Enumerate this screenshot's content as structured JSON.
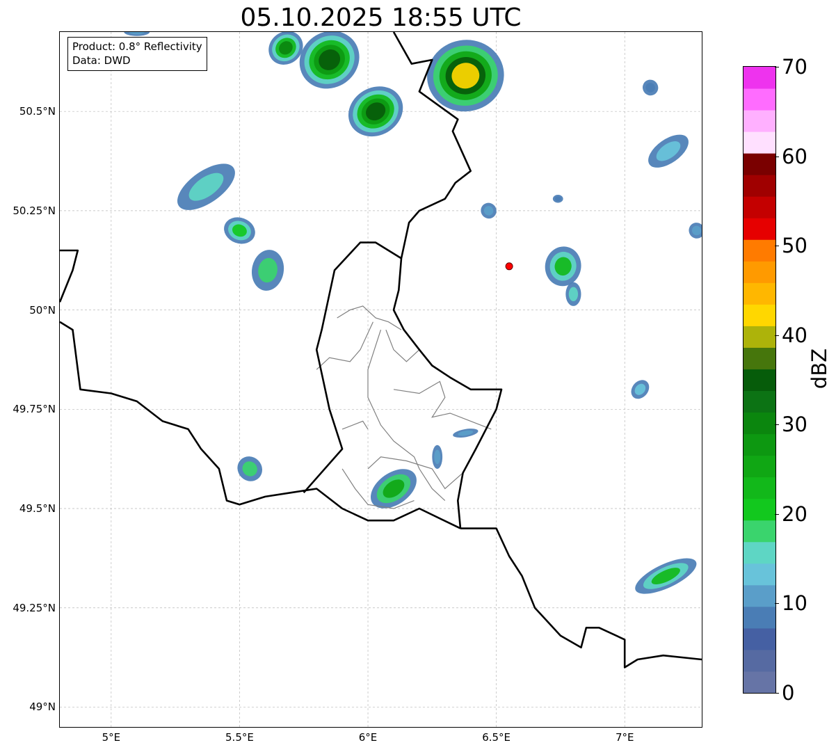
{
  "title": "05.10.2025 18:55 UTC",
  "info": {
    "product": "Product: 0.8° Reflectivity",
    "data": "Data: DWD"
  },
  "axes": {
    "lon_range": [
      4.8,
      7.3
    ],
    "lat_range": [
      48.95,
      50.7
    ],
    "x_ticks": [
      {
        "value": 5.0,
        "label": "5°E"
      },
      {
        "value": 5.5,
        "label": "5.5°E"
      },
      {
        "value": 6.0,
        "label": "6°E"
      },
      {
        "value": 6.5,
        "label": "6.5°E"
      },
      {
        "value": 7.0,
        "label": "7°E"
      }
    ],
    "y_ticks": [
      {
        "value": 50.5,
        "label": "50.5°N"
      },
      {
        "value": 50.25,
        "label": "50.25°N"
      },
      {
        "value": 50.0,
        "label": "50°N"
      },
      {
        "value": 49.75,
        "label": "49.75°N"
      },
      {
        "value": 49.5,
        "label": "49.5°N"
      },
      {
        "value": 49.25,
        "label": "49.25°N"
      },
      {
        "value": 49.0,
        "label": "49°N"
      }
    ],
    "grid": true
  },
  "colorbar": {
    "label": "dBZ",
    "min": 0,
    "max": 70,
    "ticks": [
      {
        "value": 0,
        "label": "0"
      },
      {
        "value": 10,
        "label": "10"
      },
      {
        "value": 20,
        "label": "20"
      },
      {
        "value": 30,
        "label": "30"
      },
      {
        "value": 40,
        "label": "40"
      },
      {
        "value": 50,
        "label": "50"
      },
      {
        "value": 60,
        "label": "60"
      },
      {
        "value": 70,
        "label": "70"
      }
    ],
    "colors": [
      "#6674a6",
      "#566aa2",
      "#4560a3",
      "#4a7db5",
      "#5a9ec9",
      "#68c3da",
      "#5ed6c4",
      "#3ad46d",
      "#12c81e",
      "#12b81a",
      "#10a714",
      "#0d9811",
      "#0b860e",
      "#0c7314",
      "#065c0a",
      "#46760c",
      "#adb30a",
      "#ffd700",
      "#ffb700",
      "#ff9a00",
      "#ff7b00",
      "#e60000",
      "#c40000",
      "#a00000",
      "#7a0000",
      "#ffe0ff",
      "#ffb0ff",
      "#ff6cff",
      "#ee33ee"
    ]
  },
  "marker": {
    "lon": 6.55,
    "lat": 50.11,
    "color": "#ff0000"
  },
  "echoes": [
    {
      "lon": 5.85,
      "lat": 50.63,
      "rx": 0.12,
      "ry": 0.07,
      "angle": -35,
      "level": 14
    },
    {
      "lon": 6.03,
      "lat": 50.5,
      "rx": 0.11,
      "ry": 0.06,
      "angle": -30,
      "level": 14
    },
    {
      "lon": 6.38,
      "lat": 50.59,
      "rx": 0.15,
      "ry": 0.09,
      "angle": -10,
      "level": 17
    },
    {
      "lon": 5.68,
      "lat": 50.66,
      "rx": 0.07,
      "ry": 0.04,
      "angle": -40,
      "level": 12
    },
    {
      "lon": 5.37,
      "lat": 50.31,
      "rx": 0.13,
      "ry": 0.04,
      "angle": -35,
      "level": 6
    },
    {
      "lon": 5.5,
      "lat": 50.2,
      "rx": 0.05,
      "ry": 0.04,
      "angle": -70,
      "level": 8
    },
    {
      "lon": 5.61,
      "lat": 50.1,
      "rx": 0.08,
      "ry": 0.04,
      "angle": -80,
      "level": 7
    },
    {
      "lon": 6.76,
      "lat": 50.11,
      "rx": 0.07,
      "ry": 0.05,
      "angle": 10,
      "level": 9
    },
    {
      "lon": 6.8,
      "lat": 50.04,
      "rx": 0.03,
      "ry": 0.03,
      "angle": 0,
      "level": 6
    },
    {
      "lon": 7.16,
      "lat": 49.33,
      "rx": 0.13,
      "ry": 0.03,
      "angle": -25,
      "level": 9
    },
    {
      "lon": 6.1,
      "lat": 49.55,
      "rx": 0.1,
      "ry": 0.04,
      "angle": -35,
      "level": 10
    },
    {
      "lon": 5.54,
      "lat": 49.6,
      "rx": 0.05,
      "ry": 0.03,
      "angle": 45,
      "level": 7
    },
    {
      "lon": 7.17,
      "lat": 50.4,
      "rx": 0.09,
      "ry": 0.03,
      "angle": -35,
      "level": 5
    },
    {
      "lon": 7.06,
      "lat": 49.8,
      "rx": 0.04,
      "ry": 0.02,
      "angle": -50,
      "level": 5
    },
    {
      "lon": 6.47,
      "lat": 50.25,
      "rx": 0.03,
      "ry": 0.02,
      "angle": -40,
      "level": 4
    },
    {
      "lon": 6.74,
      "lat": 50.28,
      "rx": 0.02,
      "ry": 0.01,
      "angle": 0,
      "level": 3
    },
    {
      "lon": 7.28,
      "lat": 50.2,
      "rx": 0.03,
      "ry": 0.02,
      "angle": -30,
      "level": 4
    },
    {
      "lon": 6.38,
      "lat": 49.69,
      "rx": 0.05,
      "ry": 0.01,
      "angle": -10,
      "level": 4
    },
    {
      "lon": 6.27,
      "lat": 49.63,
      "rx": 0.02,
      "ry": 0.03,
      "angle": 0,
      "level": 4
    },
    {
      "lon": 7.1,
      "lat": 50.56,
      "rx": 0.03,
      "ry": 0.02,
      "angle": -30,
      "level": 3
    },
    {
      "lon": 5.1,
      "lat": 50.7,
      "rx": 0.05,
      "ry": 0.01,
      "angle": 0,
      "level": 4
    }
  ],
  "borders": {
    "national": [
      [
        [
          6.1,
          50.7
        ],
        [
          6.17,
          50.62
        ],
        [
          6.25,
          50.63
        ],
        [
          6.2,
          50.55
        ],
        [
          6.35,
          50.48
        ],
        [
          6.33,
          50.45
        ],
        [
          6.4,
          50.35
        ],
        [
          6.34,
          50.32
        ],
        [
          6.3,
          50.28
        ],
        [
          6.2,
          50.25
        ],
        [
          6.16,
          50.22
        ],
        [
          6.13,
          50.13
        ],
        [
          6.12,
          50.05
        ],
        [
          6.1,
          50.0
        ],
        [
          6.14,
          49.95
        ],
        [
          6.2,
          49.9
        ],
        [
          6.25,
          49.86
        ],
        [
          6.32,
          49.83
        ],
        [
          6.4,
          49.8
        ],
        [
          6.48,
          49.8
        ],
        [
          6.52,
          49.8
        ],
        [
          6.5,
          49.75
        ],
        [
          6.42,
          49.65
        ],
        [
          6.37,
          49.59
        ],
        [
          6.35,
          49.52
        ],
        [
          6.36,
          49.45
        ]
      ],
      [
        [
          6.36,
          49.45
        ],
        [
          6.5,
          49.45
        ],
        [
          6.55,
          49.38
        ],
        [
          6.6,
          49.33
        ],
        [
          6.65,
          49.25
        ],
        [
          6.75,
          49.18
        ],
        [
          6.83,
          49.15
        ],
        [
          6.85,
          49.2
        ],
        [
          6.9,
          49.2
        ],
        [
          7.0,
          49.17
        ],
        [
          7.0,
          49.1
        ],
        [
          7.05,
          49.12
        ],
        [
          7.15,
          49.13
        ],
        [
          7.3,
          49.12
        ]
      ],
      [
        [
          4.8,
          49.97
        ],
        [
          4.85,
          49.95
        ],
        [
          4.88,
          49.8
        ],
        [
          5.0,
          49.79
        ],
        [
          5.1,
          49.77
        ],
        [
          5.2,
          49.72
        ],
        [
          5.3,
          49.7
        ],
        [
          5.35,
          49.65
        ],
        [
          5.42,
          49.6
        ],
        [
          5.45,
          49.52
        ],
        [
          5.5,
          49.51
        ],
        [
          5.6,
          49.53
        ],
        [
          5.7,
          49.54
        ],
        [
          5.8,
          49.55
        ],
        [
          5.9,
          49.5
        ],
        [
          6.0,
          49.47
        ],
        [
          6.1,
          49.47
        ],
        [
          6.2,
          49.5
        ],
        [
          6.36,
          49.45
        ]
      ],
      [
        [
          4.8,
          50.15
        ],
        [
          4.87,
          50.15
        ],
        [
          4.85,
          50.1
        ],
        [
          4.8,
          50.02
        ]
      ],
      [
        [
          5.75,
          49.54
        ],
        [
          5.9,
          49.65
        ],
        [
          5.85,
          49.75
        ],
        [
          5.8,
          49.9
        ],
        [
          5.82,
          49.95
        ],
        [
          5.87,
          50.1
        ],
        [
          5.97,
          50.17
        ],
        [
          6.03,
          50.17
        ],
        [
          6.13,
          50.13
        ]
      ]
    ],
    "regional": [
      [
        [
          5.88,
          49.98
        ],
        [
          5.93,
          50.0
        ],
        [
          5.98,
          50.01
        ],
        [
          6.03,
          49.98
        ],
        [
          6.08,
          49.97
        ],
        [
          6.13,
          49.95
        ]
      ],
      [
        [
          6.02,
          49.97
        ],
        [
          5.97,
          49.9
        ],
        [
          5.93,
          49.87
        ],
        [
          5.85,
          49.88
        ],
        [
          5.8,
          49.85
        ]
      ],
      [
        [
          6.05,
          49.95
        ],
        [
          6.0,
          49.85
        ],
        [
          6.0,
          49.78
        ],
        [
          6.05,
          49.71
        ],
        [
          6.1,
          49.67
        ],
        [
          6.18,
          49.63
        ],
        [
          6.2,
          49.6
        ],
        [
          6.25,
          49.55
        ],
        [
          6.3,
          49.52
        ]
      ],
      [
        [
          6.1,
          49.8
        ],
        [
          6.2,
          49.79
        ],
        [
          6.28,
          49.82
        ],
        [
          6.3,
          49.78
        ],
        [
          6.25,
          49.73
        ],
        [
          6.32,
          49.74
        ],
        [
          6.4,
          49.72
        ],
        [
          6.48,
          49.7
        ]
      ],
      [
        [
          6.0,
          49.6
        ],
        [
          6.05,
          49.63
        ],
        [
          6.15,
          49.62
        ],
        [
          6.25,
          49.6
        ],
        [
          6.3,
          49.55
        ],
        [
          6.37,
          49.59
        ]
      ],
      [
        [
          5.9,
          49.6
        ],
        [
          5.95,
          49.55
        ],
        [
          6.0,
          49.51
        ],
        [
          6.1,
          49.5
        ],
        [
          6.18,
          49.52
        ]
      ],
      [
        [
          6.07,
          49.95
        ],
        [
          6.1,
          49.9
        ],
        [
          6.15,
          49.87
        ],
        [
          6.2,
          49.9
        ]
      ],
      [
        [
          5.9,
          49.7
        ],
        [
          5.98,
          49.72
        ],
        [
          6.0,
          49.7
        ]
      ]
    ]
  }
}
